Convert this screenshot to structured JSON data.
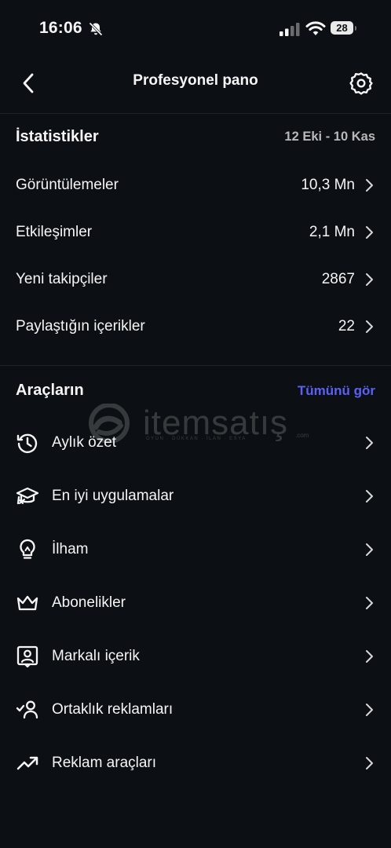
{
  "status_bar": {
    "time": "16:06",
    "battery": "28"
  },
  "header": {
    "title": "Profesyonel pano"
  },
  "stats": {
    "title": "İstatistikler",
    "date_range": "12 Eki - 10 Kas",
    "rows": [
      {
        "label": "Görüntülemeler",
        "value": "10,3 Mn"
      },
      {
        "label": "Etkileşimler",
        "value": "2,1 Mn"
      },
      {
        "label": "Yeni takipçiler",
        "value": "2867"
      },
      {
        "label": "Paylaştığın içerikler",
        "value": "22"
      }
    ]
  },
  "tools": {
    "title": "Araçların",
    "see_all": "Tümünü gör",
    "items": [
      {
        "label": "Aylık özet",
        "icon": "history-icon"
      },
      {
        "label": "En iyi uygulamalar",
        "icon": "graduation-cap-icon"
      },
      {
        "label": "İlham",
        "icon": "lightbulb-icon"
      },
      {
        "label": "Abonelikler",
        "icon": "crown-icon"
      },
      {
        "label": "Markalı içerik",
        "icon": "id-badge-icon"
      },
      {
        "label": "Ortaklık reklamları",
        "icon": "user-check-icon"
      },
      {
        "label": "Reklam araçları",
        "icon": "trending-up-icon"
      }
    ]
  },
  "watermark": {
    "brand": "itemsatış",
    "tagline": "OYUN · DÜKKAN · İLAN · ESYA",
    "domain": ".com"
  },
  "colors": {
    "background": "#0c1014",
    "accent": "#5b61f5",
    "divider": "#1f2328",
    "muted": "#b8b8b8"
  }
}
